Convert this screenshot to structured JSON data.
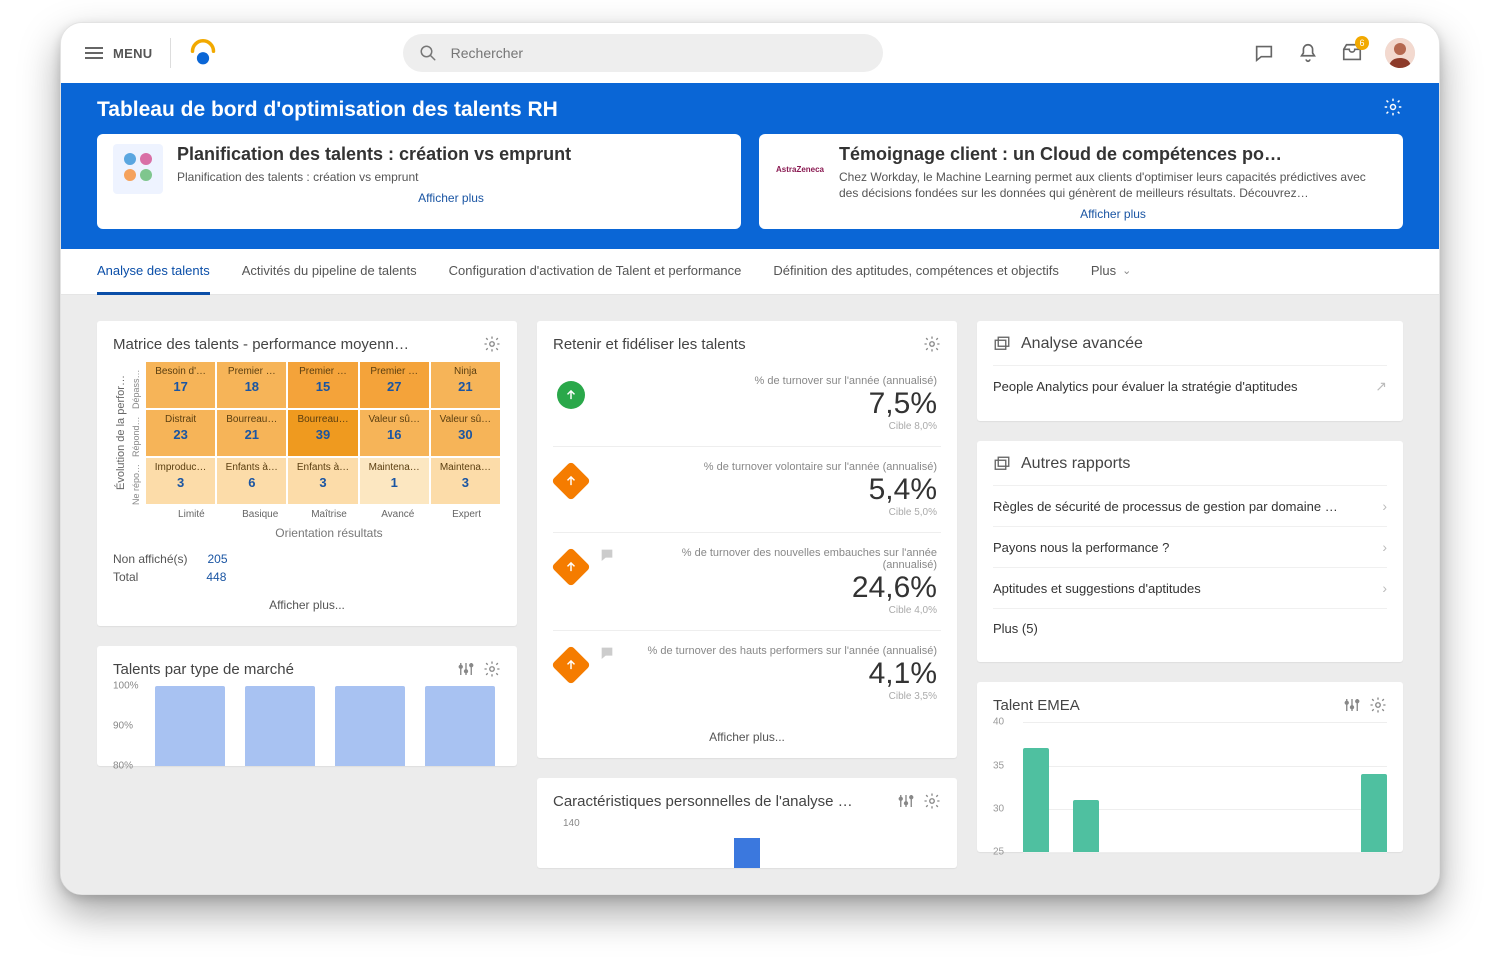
{
  "appbar": {
    "menu": "MENU",
    "search_placeholder": "Rechercher",
    "inbox_badge": "6"
  },
  "hero": {
    "title": "Tableau de bord d'optimisation des talents RH",
    "cards": [
      {
        "title": "Planification des talents : création vs emprunt",
        "subtitle": "Planification des talents : création vs emprunt",
        "more": "Afficher plus"
      },
      {
        "title": "Témoignage client : un Cloud de compétences po…",
        "subtitle": "Chez Workday, le Machine Learning permet aux clients d'optimiser leurs capacités prédictives avec des décisions fondées sur les données qui génèrent de meilleurs résultats. Découvrez…",
        "more": "Afficher plus",
        "thumb_label": "AstraZeneca"
      }
    ]
  },
  "tabs": {
    "items": [
      "Analyse des talents",
      "Activités du pipeline de talents",
      "Configuration d'activation de Talent et performance",
      "Définition des aptitudes, compétences et objectifs"
    ],
    "more": "Plus"
  },
  "matrix_card": {
    "title": "Matrice des talents - performance moyenn…",
    "y_label": "Évolution de la perfor…",
    "y_ticks": [
      "Dépass…",
      "Répond…",
      "Ne répo…"
    ],
    "x_ticks": [
      "Limité",
      "Basique",
      "Maîtrise",
      "Avancé",
      "Expert"
    ],
    "x_label": "Orientation résultats",
    "cells": [
      [
        {
          "l": "Besoin d'…",
          "v": 17
        },
        {
          "l": "Premier …",
          "v": 18
        },
        {
          "l": "Premier …",
          "v": 15
        },
        {
          "l": "Premier …",
          "v": 27
        },
        {
          "l": "Ninja",
          "v": 21
        }
      ],
      [
        {
          "l": "Distrait",
          "v": 23
        },
        {
          "l": "Bourreau…",
          "v": 21
        },
        {
          "l": "Bourreau…",
          "v": 39
        },
        {
          "l": "Valeur sû…",
          "v": 16
        },
        {
          "l": "Valeur sû…",
          "v": 30
        }
      ],
      [
        {
          "l": "Improduc…",
          "v": 3
        },
        {
          "l": "Enfants à…",
          "v": 6
        },
        {
          "l": "Enfants à…",
          "v": 3
        },
        {
          "l": "Maintena…",
          "v": 1
        },
        {
          "l": "Maintena…",
          "v": 3
        }
      ]
    ],
    "colors": [
      [
        "#f6b458",
        "#f6b458",
        "#f4a33a",
        "#f4a33a",
        "#f6b458"
      ],
      [
        "#f6b458",
        "#f6b458",
        "#ef9a1f",
        "#f6b458",
        "#f6b458"
      ],
      [
        "#fcdca9",
        "#fcdca9",
        "#fcdca9",
        "#fce7c1",
        "#fcdca9"
      ]
    ],
    "not_shown_label": "Non affiché(s)",
    "not_shown": 205,
    "total_label": "Total",
    "total": 448,
    "more": "Afficher plus..."
  },
  "market_card": {
    "title": "Talents par type de marché",
    "y_ticks": [
      "100%",
      "90%",
      "80%"
    ]
  },
  "retain_card": {
    "title": "Retenir et fidéliser les talents",
    "kpis": [
      {
        "status": "green",
        "dir": "up",
        "label": "% de turnover sur l'année (annualisé)",
        "value": "7,5%",
        "target": "Cible  8,0%"
      },
      {
        "status": "orange",
        "dir": "up",
        "label": "% de turnover volontaire sur l'année (annualisé)",
        "value": "5,4%",
        "target": "Cible  5,0%"
      },
      {
        "status": "orange",
        "dir": "up",
        "chat": true,
        "label": "% de turnover des nouvelles embauches sur l'année (annualisé)",
        "value": "24,6%",
        "target": "Cible  4,0%"
      },
      {
        "status": "orange",
        "dir": "up",
        "chat": true,
        "label": "% de turnover des hauts performers sur l'année (annualisé)",
        "value": "4,1%",
        "target": "Cible  3,5%"
      }
    ],
    "more": "Afficher plus..."
  },
  "traits_card": {
    "title": "Caractéristiques personnelles de l'analyse …",
    "y_tick": "140"
  },
  "adv_card": {
    "title": "Analyse avancée",
    "items": [
      "People Analytics pour évaluer la stratégie d'aptitudes"
    ]
  },
  "other_card": {
    "title": "Autres rapports",
    "items": [
      "Règles de sécurité de processus de gestion par domaine …",
      "Payons nous la performance ?",
      "Aptitudes et suggestions d'aptitudes",
      "Plus (5)"
    ]
  },
  "emea_card": {
    "title": "Talent EMEA",
    "y_ticks": [
      40,
      35,
      30,
      25
    ],
    "bars": [
      37,
      31,
      34
    ]
  },
  "chart_data": [
    {
      "type": "table",
      "title": "Matrice des talents - performance moyenne",
      "x_categories": [
        "Limité",
        "Basique",
        "Maîtrise",
        "Avancé",
        "Expert"
      ],
      "y_categories": [
        "Dépasse",
        "Répond",
        "Ne répond pas"
      ],
      "values": [
        [
          17,
          18,
          15,
          27,
          21
        ],
        [
          23,
          21,
          39,
          16,
          30
        ],
        [
          3,
          6,
          3,
          1,
          3
        ]
      ],
      "xlabel": "Orientation résultats",
      "ylabel": "Évolution de la performance",
      "not_shown": 205,
      "total": 448
    },
    {
      "type": "bar",
      "title": "Talents par type de marché",
      "categories": [
        "",
        "",
        "",
        ""
      ],
      "values": [
        100,
        100,
        100,
        100
      ],
      "ylabel": "%",
      "ylim": [
        80,
        100
      ]
    },
    {
      "type": "bar",
      "title": "Talent EMEA",
      "categories": [
        "",
        "",
        ""
      ],
      "values": [
        37,
        31,
        34
      ],
      "ylim": [
        25,
        40
      ]
    }
  ]
}
